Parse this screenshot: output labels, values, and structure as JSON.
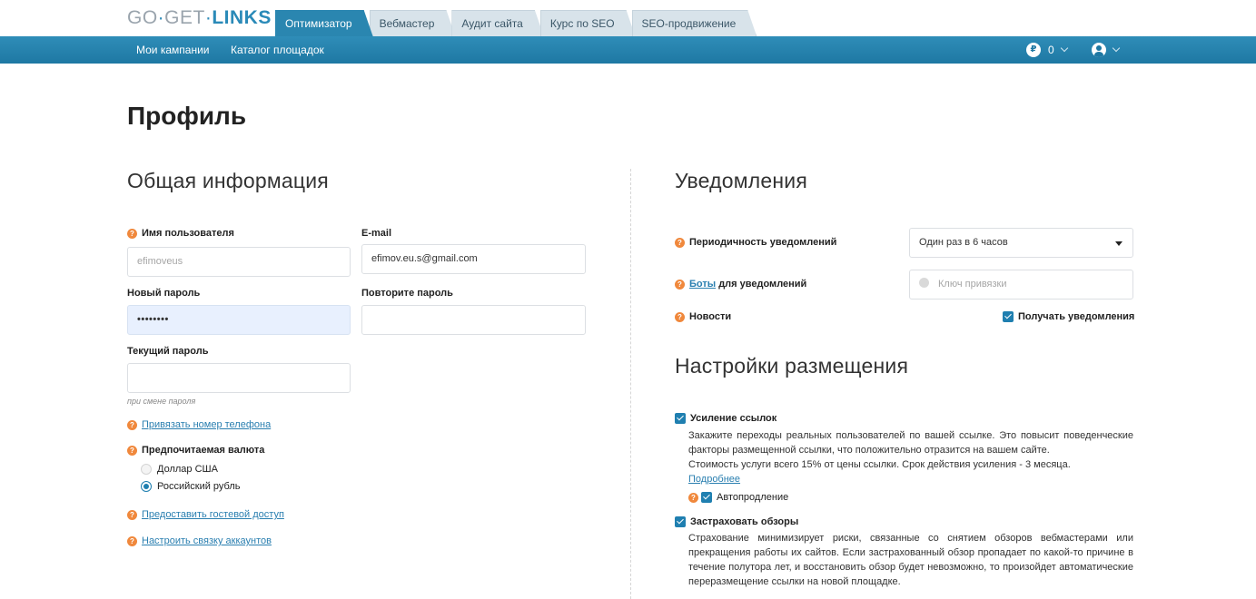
{
  "header": {
    "logo_part1": "GO",
    "logo_dot1": "·",
    "logo_part2": "GET",
    "logo_dot2": "·",
    "logo_part3": "LINKS",
    "tabs": [
      {
        "label": "Оптимизатор",
        "active": true
      },
      {
        "label": "Вебмастер",
        "active": false
      },
      {
        "label": "Аудит сайта",
        "active": false
      },
      {
        "label": "Курс по SEO",
        "active": false
      },
      {
        "label": "SEO-продвижение",
        "active": false
      }
    ]
  },
  "navbar": {
    "links": [
      "Мои кампании",
      "Каталог площадок"
    ],
    "balance_icon": "₽",
    "balance_value": "0",
    "user_icon": "user-icon"
  },
  "page": {
    "title": "Профиль"
  },
  "general": {
    "title": "Общая информация",
    "username_label": "Имя пользователя",
    "username_value": "efimoveus",
    "email_label": "E-mail",
    "email_value": "efimov.eu.s@gmail.com",
    "new_password_label": "Новый пароль",
    "new_password_value": "••••••••",
    "repeat_password_label": "Повторите пароль",
    "current_password_label": "Текущий пароль",
    "current_password_hint": "при смене пароля",
    "bind_phone_link": "Привязать номер телефона",
    "currency_label": "Предпочитаемая валюта",
    "currency_options": [
      {
        "label": "Доллар США",
        "selected": false
      },
      {
        "label": "Российский рубль",
        "selected": true
      }
    ],
    "guest_access_link": "Предоставить гостевой доступ",
    "link_accounts_link": "Настроить связку аккаунтов"
  },
  "notifications": {
    "title": "Уведомления",
    "period_label": "Периодичность уведомлений",
    "period_value": "Один раз в 6 часов",
    "bots_link": "Боты",
    "bots_label_rest": " для уведомлений",
    "bind_key_placeholder": "Ключ привязки",
    "news_label": "Новости",
    "receive_label": "Получать уведомления",
    "receive_checked": true
  },
  "placement": {
    "title": "Настройки размещения",
    "boost_label": "Усиление ссылок",
    "boost_checked": true,
    "boost_desc": "Закажите переходы реальных пользователей по вашей ссылке. Это повысит поведенческие факторы размещенной ссылки, что положительно отразится на вашем сайте.",
    "boost_cost": "Стоимость услуги всего 15% от цены ссылки. Срок действия усиления - 3 месяца.",
    "more_link": "Подробнее",
    "autorenew_label": "Автопродление",
    "autorenew_checked": true,
    "insure_label": "Застраховать обзоры",
    "insure_checked": true,
    "insure_desc": "Страхование минимизирует риски, связанные со снятием обзоров вебмастерами или прекращения работы их сайтов. Если застрахованный обзор пропадает по какой-то причине в течение полутора лет, и восстановить обзор будет невозможно, то произойдет автоматические переразмещение ссылки на новой площадке."
  },
  "colors": {
    "accent": "#2a86b0",
    "navbar": "#1e78a3",
    "question_mark": "#f0883c",
    "link": "#2a7fb0"
  }
}
